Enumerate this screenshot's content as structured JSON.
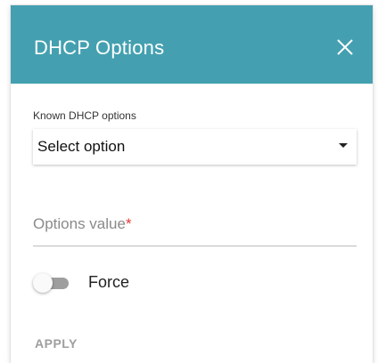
{
  "dialog": {
    "title": "DHCP Options",
    "close_icon": "close-icon",
    "header_color": "#44a0b0"
  },
  "known_options": {
    "label": "Known DHCP options",
    "selected": "Select option"
  },
  "options_value": {
    "placeholder": "Options value",
    "required_mark": "*"
  },
  "force": {
    "label": "Force",
    "enabled": false
  },
  "actions": {
    "apply_label": "APPLY",
    "apply_enabled": false
  }
}
